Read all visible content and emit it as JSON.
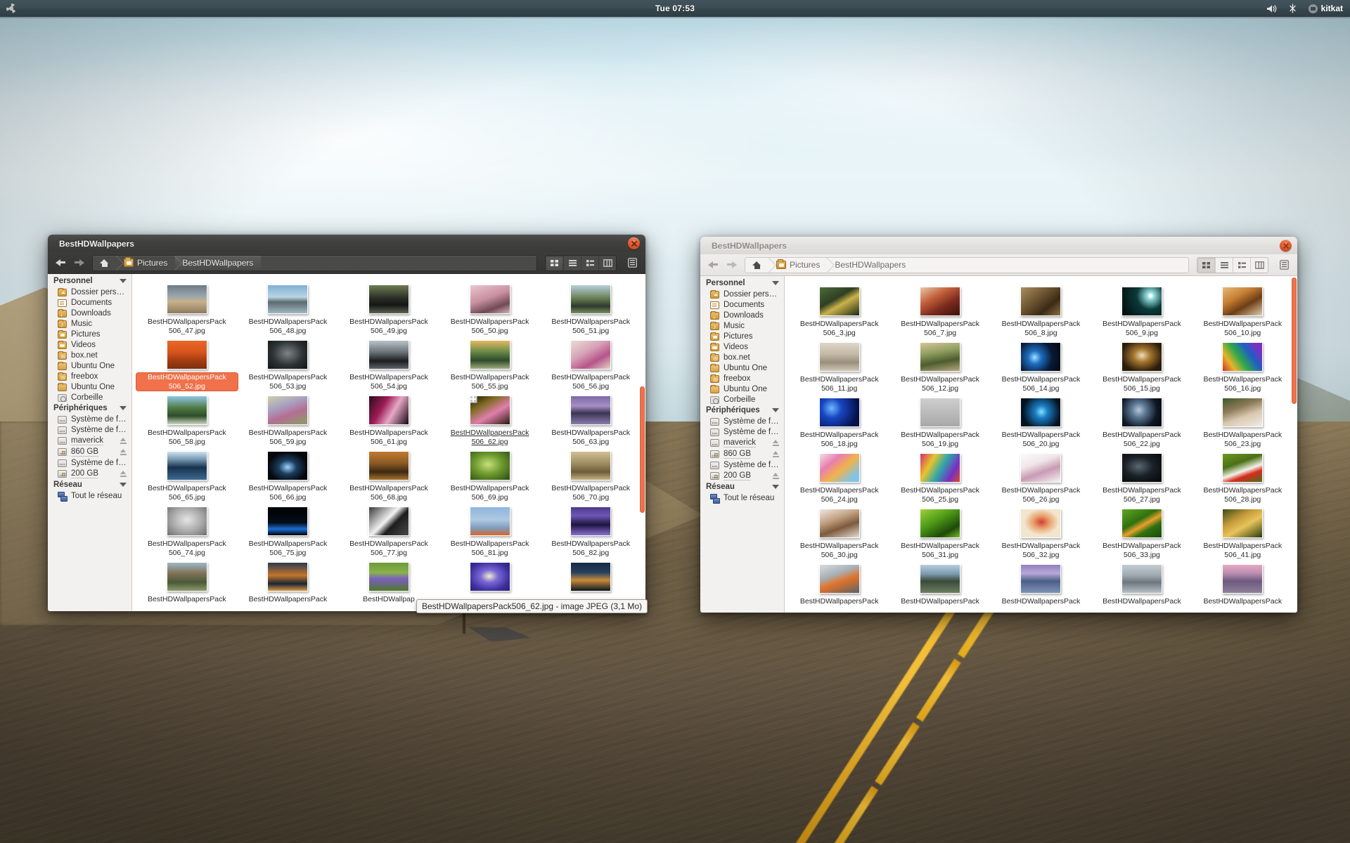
{
  "panel": {
    "logo_icon": "ubuntu-logo-icon",
    "clock": "Tue 07:53",
    "volume_icon": "volume-icon",
    "bluetooth_icon": "bluetooth-icon",
    "user_icon": "user-avatar-icon",
    "username": "kitkat"
  },
  "sidebar": {
    "sections": [
      {
        "title": "Personnel",
        "items": [
          {
            "label": "Dossier personnel",
            "icon": "home-folder-icon",
            "eject": false
          },
          {
            "label": "Documents",
            "icon": "documents-folder-icon",
            "eject": false
          },
          {
            "label": "Downloads",
            "icon": "downloads-folder-icon",
            "eject": false
          },
          {
            "label": "Music",
            "icon": "music-folder-icon",
            "eject": false
          },
          {
            "label": "Pictures",
            "icon": "pictures-folder-icon",
            "eject": false
          },
          {
            "label": "Videos",
            "icon": "videos-folder-icon",
            "eject": false
          },
          {
            "label": "box.net",
            "icon": "network-folder-icon",
            "eject": false
          },
          {
            "label": "Ubuntu One",
            "icon": "plain-folder-icon",
            "eject": false
          },
          {
            "label": "freebox",
            "icon": "network-folder-icon",
            "eject": false
          },
          {
            "label": "Ubuntu One",
            "icon": "plain-folder-icon",
            "eject": false
          },
          {
            "label": "Corbeille",
            "icon": "trash-icon",
            "eject": false
          }
        ]
      },
      {
        "title": "Périphériques",
        "items": [
          {
            "label": "Système de fichier",
            "icon": "drive-icon",
            "eject": false
          },
          {
            "label": "Système de fichier...",
            "icon": "drive-icon",
            "eject": false
          },
          {
            "label": "maverick",
            "icon": "drive-icon",
            "eject": true
          },
          {
            "label": "860 GB",
            "icon": "drive-tagged-icon",
            "eject": true
          },
          {
            "label": "Système de fichier...",
            "icon": "drive-icon",
            "eject": false
          },
          {
            "label": "200 GB",
            "icon": "drive-tagged-icon",
            "eject": true
          }
        ]
      },
      {
        "title": "Réseau",
        "items": [
          {
            "label": "Tout le réseau",
            "icon": "network-icon",
            "eject": false
          }
        ]
      }
    ]
  },
  "window_left": {
    "title": "BestHDWallpapers",
    "state": "active",
    "close_icon": "close-icon",
    "nav": {
      "back_icon": "back-arrow-icon",
      "forward_icon": "forward-arrow-icon"
    },
    "breadcrumbs": [
      {
        "label": "",
        "icon": "home-icon"
      },
      {
        "label": "Pictures",
        "icon": "pictures-folder-icon"
      },
      {
        "label": "BestHDWallpapers",
        "icon": ""
      }
    ],
    "view_buttons": [
      {
        "name": "icon-view",
        "icon": "grid-view-icon",
        "selected": true
      },
      {
        "name": "list-view",
        "icon": "list-view-icon",
        "selected": false
      },
      {
        "name": "compact-view",
        "icon": "compact-view-icon",
        "selected": false
      },
      {
        "name": "column-view",
        "icon": "column-view-icon",
        "selected": false
      }
    ],
    "extra_button": {
      "name": "toggle-sidebar",
      "icon": "sidebar-toggle-icon"
    },
    "files": [
      {
        "name": "BestHDWallpapersPack\n506_47.jpg",
        "state": "normal",
        "thumb": "pier-sunset"
      },
      {
        "name": "BestHDWallpapersPack\n506_48.jpg",
        "state": "normal",
        "thumb": "rock-sea"
      },
      {
        "name": "BestHDWallpapersPack\n506_49.jpg",
        "state": "normal",
        "thumb": "black-car"
      },
      {
        "name": "BestHDWallpapersPack\n506_50.jpg",
        "state": "normal",
        "thumb": "pink-room"
      },
      {
        "name": "BestHDWallpapersPack\n506_51.jpg",
        "state": "normal",
        "thumb": "hiker-canyon"
      },
      {
        "name": "BestHDWallpapersPack\n506_52.jpg",
        "state": "selected",
        "thumb": "orange-road"
      },
      {
        "name": "BestHDWallpapersPack\n506_53.jpg",
        "state": "normal",
        "thumb": "dark-tunnel"
      },
      {
        "name": "BestHDWallpapersPack\n506_54.jpg",
        "state": "normal",
        "thumb": "street-car"
      },
      {
        "name": "BestHDWallpapersPack\n506_55.jpg",
        "state": "normal",
        "thumb": "waterfall"
      },
      {
        "name": "BestHDWallpapersPack\n506_56.jpg",
        "state": "normal",
        "thumb": "pink-flowers"
      },
      {
        "name": "BestHDWallpapersPack\n506_58.jpg",
        "state": "normal",
        "thumb": "green-cliff"
      },
      {
        "name": "BestHDWallpapersPack\n506_59.jpg",
        "state": "normal",
        "thumb": "garden-paint"
      },
      {
        "name": "BestHDWallpapersPack\n506_61.jpg",
        "state": "normal",
        "thumb": "anime-pink"
      },
      {
        "name": "BestHDWallpapersPack\n506_62.jpg",
        "state": "hover",
        "thumb": "blossom-dark",
        "drop_badge": true
      },
      {
        "name": "BestHDWallpapersPack\n506_63.jpg",
        "state": "normal",
        "thumb": "purple-mont"
      },
      {
        "name": "BestHDWallpapersPack\n506_65.jpg",
        "state": "normal",
        "thumb": "city-reflect"
      },
      {
        "name": "BestHDWallpapersPack\n506_66.jpg",
        "state": "normal",
        "thumb": "car-night"
      },
      {
        "name": "BestHDWallpapersPack\n506_68.jpg",
        "state": "normal",
        "thumb": "autumn-path"
      },
      {
        "name": "BestHDWallpapersPack\n506_69.jpg",
        "state": "normal",
        "thumb": "dew-leaf"
      },
      {
        "name": "BestHDWallpapersPack\n506_70.jpg",
        "state": "normal",
        "thumb": "humvee"
      },
      {
        "name": "BestHDWallpapersPack\n506_74.jpg",
        "state": "normal",
        "thumb": "robot-grey"
      },
      {
        "name": "BestHDWallpapersPack\n506_75.jpg",
        "state": "normal",
        "thumb": "black-blue"
      },
      {
        "name": "BestHDWallpapersPack\n506_77.jpg",
        "state": "normal",
        "thumb": "nvidia-logo"
      },
      {
        "name": "BestHDWallpapersPack\n506_81.jpg",
        "state": "normal",
        "thumb": "kite-sky"
      },
      {
        "name": "BestHDWallpapersPack\n506_82.jpg",
        "state": "normal",
        "thumb": "skyline-purple"
      },
      {
        "name": "BestHDWallpapersPack",
        "state": "normal",
        "thumb": "old-street"
      },
      {
        "name": "BestHDWallpapersPack",
        "state": "normal",
        "thumb": "city-canal"
      },
      {
        "name": "BestHDWallpap",
        "state": "normal",
        "thumb": "crocus"
      },
      {
        "name": "",
        "state": "normal",
        "thumb": "blue-anemone"
      },
      {
        "name": "",
        "state": "normal",
        "thumb": "night-city"
      }
    ],
    "tooltip": "BestHDWallpapersPack506_62.jpg - image JPEG (3,1 Mo)"
  },
  "window_right": {
    "title": "BestHDWallpapers",
    "state": "inactive",
    "close_icon": "close-icon",
    "nav": {
      "back_icon": "back-arrow-icon",
      "forward_icon": "forward-arrow-icon"
    },
    "breadcrumbs": [
      {
        "label": "",
        "icon": "home-icon"
      },
      {
        "label": "Pictures",
        "icon": "pictures-folder-icon"
      },
      {
        "label": "BestHDWallpapers",
        "icon": ""
      }
    ],
    "view_buttons": [
      {
        "name": "icon-view",
        "icon": "grid-view-icon",
        "selected": true
      },
      {
        "name": "list-view",
        "icon": "list-view-icon",
        "selected": false
      },
      {
        "name": "compact-view",
        "icon": "compact-view-icon",
        "selected": false
      },
      {
        "name": "column-view",
        "icon": "column-view-icon",
        "selected": false
      }
    ],
    "extra_button": {
      "name": "toggle-sidebar",
      "icon": "sidebar-toggle-icon"
    },
    "files": [
      {
        "name": "BestHDWallpapersPack\n506_3.jpg",
        "state": "normal",
        "thumb": "green-arrow"
      },
      {
        "name": "BestHDWallpapersPack\n506_7.jpg",
        "state": "normal",
        "thumb": "red-fantasy"
      },
      {
        "name": "BestHDWallpapersPack\n506_8.jpg",
        "state": "normal",
        "thumb": "rust-wall"
      },
      {
        "name": "BestHDWallpapersPack\n506_9.jpg",
        "state": "normal",
        "thumb": "planet-star"
      },
      {
        "name": "BestHDWallpapersPack\n506_10.jpg",
        "state": "normal",
        "thumb": "tiger"
      },
      {
        "name": "BestHDWallpapersPack\n506_11.jpg",
        "state": "normal",
        "thumb": "brooklyn-bridge"
      },
      {
        "name": "BestHDWallpapersPack\n506_12.jpg",
        "state": "normal",
        "thumb": "cottage-paint"
      },
      {
        "name": "BestHDWallpapersPack\n506_14.jpg",
        "state": "normal",
        "thumb": "blue-orb"
      },
      {
        "name": "BestHDWallpapersPack\n506_15.jpg",
        "state": "normal",
        "thumb": "tree-fantasy"
      },
      {
        "name": "BestHDWallpapersPack\n506_16.jpg",
        "state": "normal",
        "thumb": "color-blocks"
      },
      {
        "name": "BestHDWallpapersPack\n506_18.jpg",
        "state": "normal",
        "thumb": "blue-bokeh"
      },
      {
        "name": "BestHDWallpapersPack\n506_19.jpg",
        "state": "normal",
        "thumb": "grey-figure"
      },
      {
        "name": "BestHDWallpapersPack\n506_20.jpg",
        "state": "normal",
        "thumb": "cyan-bokeh"
      },
      {
        "name": "BestHDWallpapersPack\n506_22.jpg",
        "state": "normal",
        "thumb": "ringed-planet"
      },
      {
        "name": "BestHDWallpapersPack\n506_23.jpg",
        "state": "normal",
        "thumb": "kitten"
      },
      {
        "name": "BestHDWallpapersPack\n506_24.jpg",
        "state": "normal",
        "thumb": "toys-pink"
      },
      {
        "name": "BestHDWallpapersPack\n506_25.jpg",
        "state": "normal",
        "thumb": "colorful-art"
      },
      {
        "name": "BestHDWallpapersPack\n506_26.jpg",
        "state": "normal",
        "thumb": "tree-white"
      },
      {
        "name": "BestHDWallpapersPack\n506_27.jpg",
        "state": "normal",
        "thumb": "dark-armor"
      },
      {
        "name": "BestHDWallpapersPack\n506_28.jpg",
        "state": "normal",
        "thumb": "ladybug-daisy"
      },
      {
        "name": "BestHDWallpapersPack\n506_30.jpg",
        "state": "normal",
        "thumb": "cappuccino"
      },
      {
        "name": "BestHDWallpapersPack\n506_31.jpg",
        "state": "normal",
        "thumb": "clover"
      },
      {
        "name": "BestHDWallpapersPack\n506_32.jpg",
        "state": "normal",
        "thumb": "red-handprint"
      },
      {
        "name": "BestHDWallpapersPack\n506_33.jpg",
        "state": "normal",
        "thumb": "green-leaf"
      },
      {
        "name": "BestHDWallpapersPack\n506_41.jpg",
        "state": "normal",
        "thumb": "mushrooms"
      },
      {
        "name": "BestHDWallpapersPack",
        "state": "normal",
        "thumb": "orange-fog"
      },
      {
        "name": "BestHDWallpapersPack",
        "state": "normal",
        "thumb": "highland-lake"
      },
      {
        "name": "BestHDWallpapersPack",
        "state": "normal",
        "thumb": "purple-shore"
      },
      {
        "name": "BestHDWallpapersPack",
        "state": "normal",
        "thumb": "grey-beach"
      },
      {
        "name": "BestHDWallpapersPack",
        "state": "normal",
        "thumb": "pink-cliff"
      }
    ]
  },
  "colors": {
    "accent_orange": "#f0714a",
    "panel_bg": "#37464d",
    "active_titlebar": "#414140",
    "inactive_titlebar": "#e4e2df"
  }
}
